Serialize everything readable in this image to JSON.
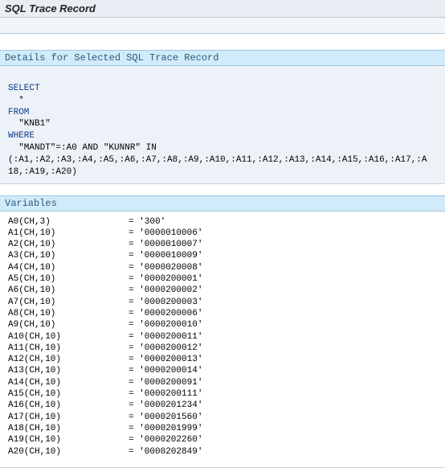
{
  "header": {
    "title": "SQL Trace Record"
  },
  "details": {
    "section_title": "Details for Selected SQL Trace Record",
    "sql": {
      "select_kw": "SELECT",
      "select_cols": "  *",
      "from_kw": "FROM",
      "from_tab": "  \"KNB1\"",
      "where_kw": "WHERE",
      "where_1": "  \"MANDT\"=:A0 AND \"KUNNR\" IN",
      "where_2": "(:A1,:A2,:A3,:A4,:A5,:A6,:A7,:A8,:A9,:A10,:A11,:A12,:A13,:A14,:A15,:A16,:A17,:A",
      "where_3": "18,:A19,:A20)"
    }
  },
  "variables": {
    "section_title": "Variables",
    "rows": [
      {
        "name": "A0(CH,3)",
        "value": "= '300'"
      },
      {
        "name": "A1(CH,10)",
        "value": "= '0000010006'"
      },
      {
        "name": "A2(CH,10)",
        "value": "= '0000010007'"
      },
      {
        "name": "A3(CH,10)",
        "value": "= '0000010009'"
      },
      {
        "name": "A4(CH,10)",
        "value": "= '0000020008'"
      },
      {
        "name": "A5(CH,10)",
        "value": "= '0000200001'"
      },
      {
        "name": "A6(CH,10)",
        "value": "= '0000200002'"
      },
      {
        "name": "A7(CH,10)",
        "value": "= '0000200003'"
      },
      {
        "name": "A8(CH,10)",
        "value": "= '0000200006'"
      },
      {
        "name": "A9(CH,10)",
        "value": "= '0000200010'"
      },
      {
        "name": "A10(CH,10)",
        "value": "= '0000200011'"
      },
      {
        "name": "A11(CH,10)",
        "value": "= '0000200012'"
      },
      {
        "name": "A12(CH,10)",
        "value": "= '0000200013'"
      },
      {
        "name": "A13(CH,10)",
        "value": "= '0000200014'"
      },
      {
        "name": "A14(CH,10)",
        "value": "= '0000200091'"
      },
      {
        "name": "A15(CH,10)",
        "value": "= '0000200111'"
      },
      {
        "name": "A16(CH,10)",
        "value": "= '0000201234'"
      },
      {
        "name": "A17(CH,10)",
        "value": "= '0000201560'"
      },
      {
        "name": "A18(CH,10)",
        "value": "= '0000201999'"
      },
      {
        "name": "A19(CH,10)",
        "value": "= '0000202260'"
      },
      {
        "name": "A20(CH,10)",
        "value": "= '0000202849'"
      }
    ]
  }
}
